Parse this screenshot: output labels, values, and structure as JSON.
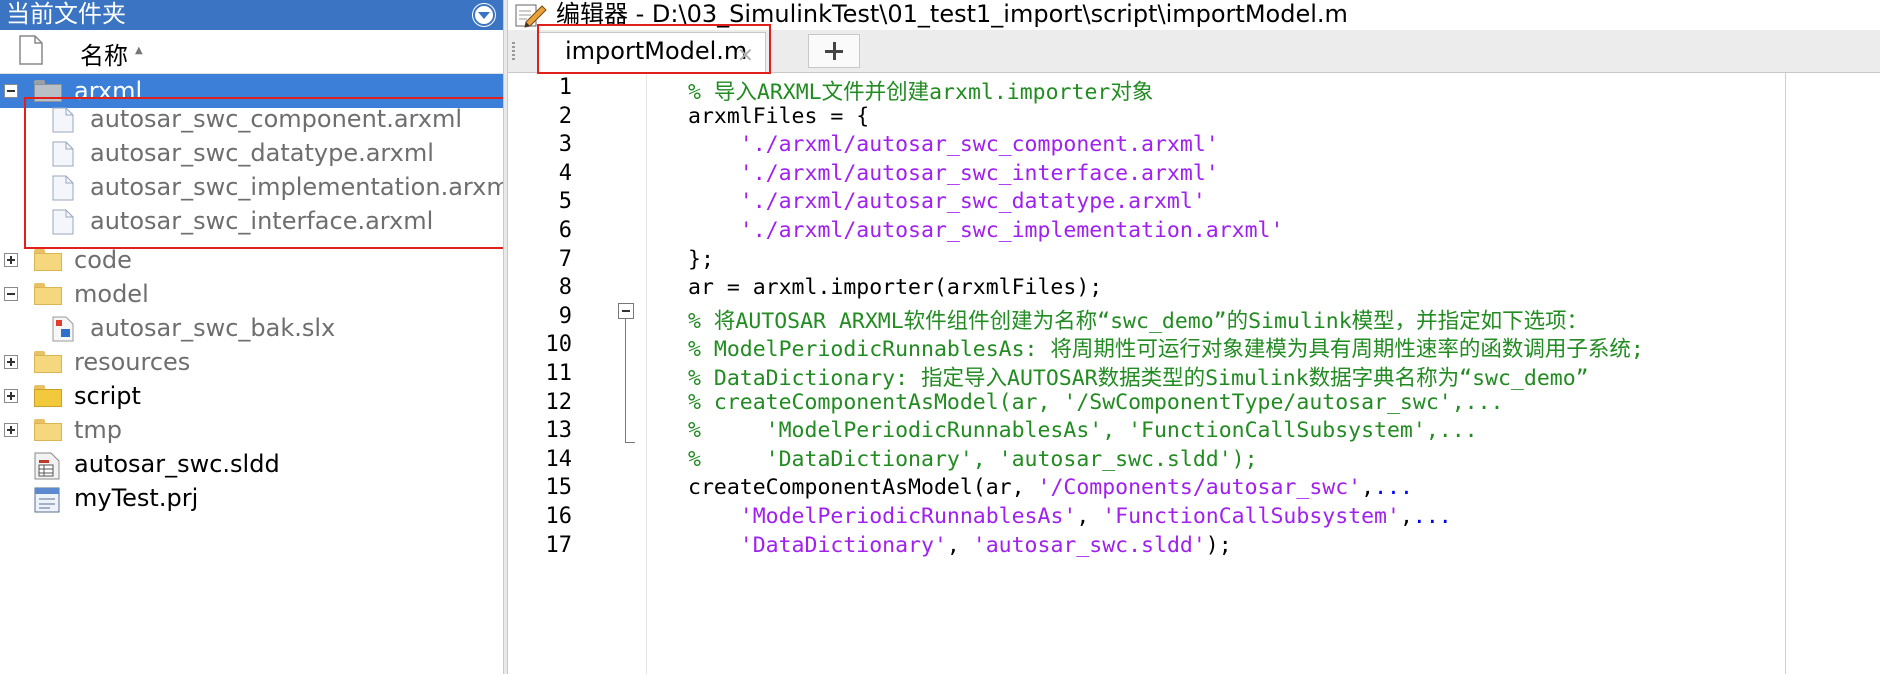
{
  "left_pane": {
    "title": "当前文件夹",
    "header_name": "名称",
    "header_sort": "▲",
    "items": [
      {
        "label": "arxml",
        "type": "folder",
        "toggle": "minus",
        "selected": true
      },
      {
        "label": "autosar_swc_component.arxml",
        "type": "file"
      },
      {
        "label": "autosar_swc_datatype.arxml",
        "type": "file"
      },
      {
        "label": "autosar_swc_implementation.arxml",
        "type": "file"
      },
      {
        "label": "autosar_swc_interface.arxml",
        "type": "file"
      },
      {
        "label": "code",
        "type": "folder",
        "toggle": "plus"
      },
      {
        "label": "model",
        "type": "folder",
        "toggle": "minus"
      },
      {
        "label": "autosar_swc_bak.slx",
        "type": "slx"
      },
      {
        "label": "resources",
        "type": "folder",
        "toggle": "plus"
      },
      {
        "label": "script",
        "type": "folder",
        "toggle": "plus"
      },
      {
        "label": "tmp",
        "type": "folder",
        "toggle": "plus"
      },
      {
        "label": "autosar_swc.sldd",
        "type": "sldd"
      },
      {
        "label": "myTest.prj",
        "type": "prj"
      }
    ]
  },
  "editor": {
    "title": "编辑器 - D:\\03_SimulinkTest\\01_test1_import\\script\\importModel.m",
    "tab_label": "importModel.m",
    "tab_close": "✕",
    "line_numbers": [
      "1",
      "2",
      "3",
      "4",
      "5",
      "6",
      "7",
      "8",
      "9",
      "10",
      "11",
      "12",
      "13",
      "14",
      "15",
      "16",
      "17"
    ],
    "lines": [
      [
        {
          "t": "% 导入ARXML文件并创建arxml.importer对象",
          "c": "cm"
        }
      ],
      [
        {
          "t": "arxmlFiles = {",
          "c": ""
        }
      ],
      [
        {
          "t": "    ",
          "c": ""
        },
        {
          "t": "'./arxml/autosar_swc_component.arxml'",
          "c": "st"
        }
      ],
      [
        {
          "t": "    ",
          "c": ""
        },
        {
          "t": "'./arxml/autosar_swc_interface.arxml'",
          "c": "st"
        }
      ],
      [
        {
          "t": "    ",
          "c": ""
        },
        {
          "t": "'./arxml/autosar_swc_datatype.arxml'",
          "c": "st"
        }
      ],
      [
        {
          "t": "    ",
          "c": ""
        },
        {
          "t": "'./arxml/autosar_swc_implementation.arxml'",
          "c": "st"
        }
      ],
      [
        {
          "t": "};",
          "c": ""
        }
      ],
      [
        {
          "t": "ar = arxml.importer(arxmlFiles);",
          "c": ""
        }
      ],
      [
        {
          "t": "% 将AUTOSAR ARXML软件组件创建为名称“swc_demo”的Simulink模型，并指定如下选项：",
          "c": "cm"
        }
      ],
      [
        {
          "t": "% ModelPeriodicRunnablesAs: 将周期性可运行对象建模为具有周期性速率的函数调用子系统;",
          "c": "cm"
        }
      ],
      [
        {
          "t": "% DataDictionary: 指定导入AUTOSAR数据类型的Simulink数据字典名称为“swc_demo”",
          "c": "cm"
        }
      ],
      [
        {
          "t": "% createComponentAsModel(ar, '/SwComponentType/autosar_swc',...",
          "c": "cm"
        }
      ],
      [
        {
          "t": "%     'ModelPeriodicRunnablesAs', 'FunctionCallSubsystem',...",
          "c": "cm"
        }
      ],
      [
        {
          "t": "%     'DataDictionary', 'autosar_swc.sldd');",
          "c": "cm"
        }
      ],
      [
        {
          "t": "createComponentAsModel(ar, ",
          "c": ""
        },
        {
          "t": "'/Components/autosar_swc'",
          "c": "st"
        },
        {
          "t": ",",
          "c": ""
        },
        {
          "t": "...",
          "c": "el"
        }
      ],
      [
        {
          "t": "    ",
          "c": ""
        },
        {
          "t": "'ModelPeriodicRunnablesAs'",
          "c": "st"
        },
        {
          "t": ", ",
          "c": ""
        },
        {
          "t": "'FunctionCallSubsystem'",
          "c": "st"
        },
        {
          "t": ",",
          "c": ""
        },
        {
          "t": "...",
          "c": "el"
        }
      ],
      [
        {
          "t": "    ",
          "c": ""
        },
        {
          "t": "'DataDictionary'",
          "c": "st"
        },
        {
          "t": ", ",
          "c": ""
        },
        {
          "t": "'autosar_swc.sldd'",
          "c": "st"
        },
        {
          "t": ");",
          "c": ""
        }
      ]
    ]
  }
}
